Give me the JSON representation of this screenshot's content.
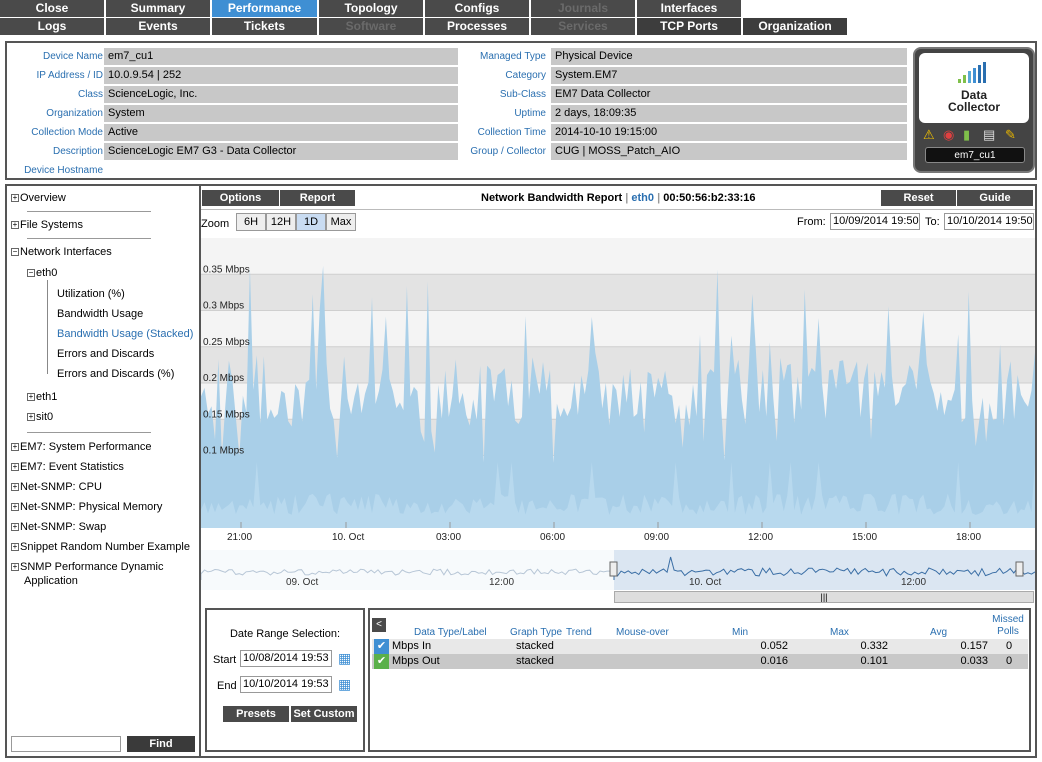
{
  "tabs": {
    "row1": [
      {
        "label": "Close",
        "state": "normal"
      },
      {
        "label": "Summary",
        "state": "normal"
      },
      {
        "label": "Performance",
        "state": "active"
      },
      {
        "label": "Topology",
        "state": "normal"
      },
      {
        "label": "Configs",
        "state": "normal"
      },
      {
        "label": "Journals",
        "state": "disabled"
      },
      {
        "label": "Interfaces",
        "state": "normal"
      }
    ],
    "row2": [
      {
        "label": "Logs",
        "state": "normal"
      },
      {
        "label": "Events",
        "state": "normal"
      },
      {
        "label": "Tickets",
        "state": "normal"
      },
      {
        "label": "Software",
        "state": "disabled"
      },
      {
        "label": "Processes",
        "state": "normal"
      },
      {
        "label": "Services",
        "state": "disabled"
      },
      {
        "label": "TCP Ports",
        "state": "normal"
      },
      {
        "label": "Organization",
        "state": "normal"
      }
    ]
  },
  "device": {
    "left": [
      {
        "label": "Device Name",
        "value": "em7_cu1"
      },
      {
        "label": "IP Address / ID",
        "value": "10.0.9.54 | 252"
      },
      {
        "label": "Class",
        "value": "ScienceLogic, Inc."
      },
      {
        "label": "Organization",
        "value": "System"
      },
      {
        "label": "Collection Mode",
        "value": "Active"
      },
      {
        "label": "Description",
        "value": "ScienceLogic EM7 G3 - Data Collector"
      },
      {
        "label": "Device Hostname",
        "value": ""
      }
    ],
    "right": [
      {
        "label": "Managed Type",
        "value": "Physical Device"
      },
      {
        "label": "Category",
        "value": "System.EM7"
      },
      {
        "label": "Sub-Class",
        "value": "EM7 Data Collector"
      },
      {
        "label": "Uptime",
        "value": "2 days, 18:09:35"
      },
      {
        "label": "Collection Time",
        "value": "2014-10-10 19:15:00"
      },
      {
        "label": "Group / Collector",
        "value": "CUG | MOSS_Patch_AIO"
      }
    ],
    "badge": {
      "title_line1": "Data",
      "title_line2": "Collector",
      "name": "em7_cu1"
    }
  },
  "tree": {
    "overview": "Overview",
    "file_systems": "File Systems",
    "network_interfaces": "Network Interfaces",
    "eth0": "eth0",
    "eth0_children": [
      "Utilization (%)",
      "Bandwidth Usage",
      "Bandwidth Usage (Stacked)",
      "Errors and Discards",
      "Errors and Discards (%)"
    ],
    "eth1": "eth1",
    "sit0": "sit0",
    "others": [
      "EM7: System Performance",
      "EM7: Event Statistics",
      "Net-SNMP: CPU",
      "Net-SNMP: Physical Memory",
      "Net-SNMP: Swap",
      "Snippet Random Number Example"
    ],
    "last_line1": "SNMP Performance Dynamic",
    "last_line2": "Application"
  },
  "find": {
    "value": "",
    "button": "Find"
  },
  "report": {
    "options": "Options",
    "report_btn": "Report",
    "title": "Network Bandwidth Report",
    "iface": "eth0",
    "mac": "00:50:56:b2:33:16",
    "reset": "Reset",
    "guide": "Guide",
    "zoom_label": "Zoom",
    "zoom": [
      "6H",
      "12H",
      "1D",
      "Max"
    ],
    "zoom_selected": "1D",
    "from_label": "From:",
    "from_value": "10/09/2014 19:50",
    "to_label": "To:",
    "to_value": "10/10/2014 19:50"
  },
  "chart_data": {
    "type": "area",
    "y_tick_labels": [
      "0.1 Mbps",
      "0.15 Mbps",
      "0.2 Mbps",
      "0.25 Mbps",
      "0.3 Mbps",
      "0.35 Mbps"
    ],
    "y_ticks": [
      0.1,
      0.15,
      0.2,
      0.25,
      0.3,
      0.35
    ],
    "ylim": [
      0,
      0.4
    ],
    "x_tick_labels": [
      "21:00",
      "10. Oct",
      "03:00",
      "06:00",
      "09:00",
      "12:00",
      "15:00",
      "18:00"
    ],
    "navigator_labels": [
      "09. Oct",
      "12:00",
      "10. Oct",
      "12:00"
    ],
    "series": [
      {
        "name": "Mbps In",
        "min": 0.052,
        "max": 0.332,
        "avg": 0.157
      },
      {
        "name": "Mbps Out",
        "min": 0.016,
        "max": 0.101,
        "avg": 0.033
      }
    ],
    "colors": {
      "in": "#a9cfe8",
      "out": "#cfe3f1"
    }
  },
  "date_range": {
    "title": "Date Range Selection:",
    "start_label": "Start",
    "start_value": "10/08/2014 19:53",
    "end_label": "End",
    "end_value": "10/10/2014 19:53",
    "presets": "Presets",
    "set_custom": "Set Custom"
  },
  "table": {
    "collapse": "<",
    "headers": [
      "Data Type/Label",
      "Graph Type",
      "Trend",
      "Mouse-over",
      "Min",
      "Max",
      "Avg",
      "Missed Polls"
    ],
    "rows": [
      {
        "label": "Mbps In",
        "graph": "stacked",
        "min": "0.052",
        "max": "0.332",
        "avg": "0.157",
        "missed": "0"
      },
      {
        "label": "Mbps Out",
        "graph": "stacked",
        "min": "0.016",
        "max": "0.101",
        "avg": "0.033",
        "missed": "0"
      }
    ]
  }
}
